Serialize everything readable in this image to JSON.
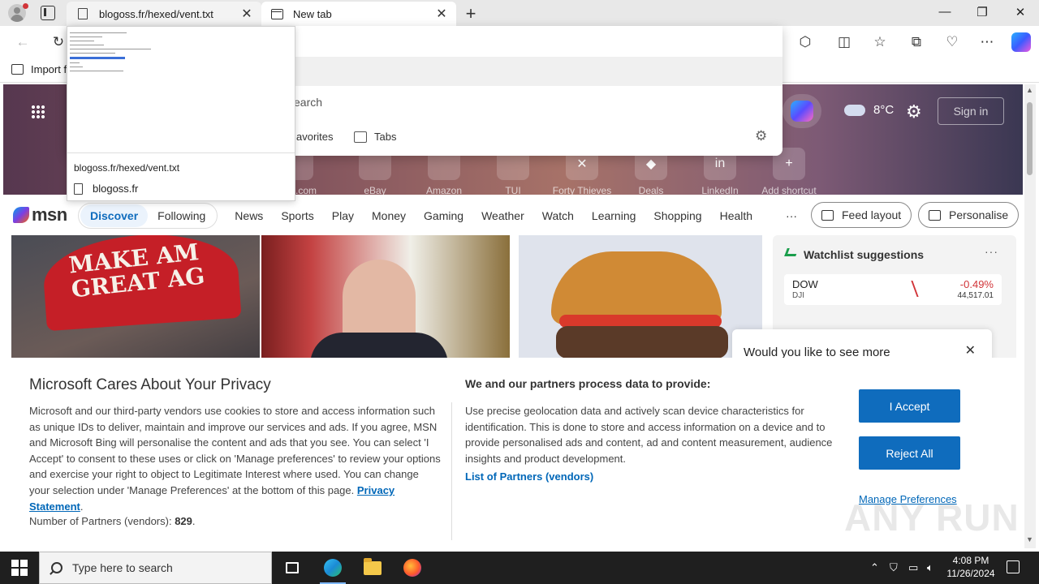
{
  "browser": {
    "tabs": [
      {
        "label": "blogoss.fr/hexed/vent.txt",
        "close": "✕"
      },
      {
        "label": "New tab",
        "close": "✕"
      }
    ],
    "new_tab": "+",
    "window_controls": {
      "minimize": "—",
      "maximize": "❐",
      "close": "✕"
    },
    "favorites_bar": {
      "import_label": "Import f"
    }
  },
  "address_dropdown": {
    "search_placeholder": "earch",
    "favorites_label": "avorites",
    "tabs_label": "Tabs"
  },
  "tab_preview": {
    "url": "blogoss.fr/hexed/vent.txt",
    "site": "blogoss.fr"
  },
  "msn": {
    "weather_temp": "8°C",
    "sign_in": "Sign in",
    "shortcuts": [
      "king.com",
      "eBay",
      "Amazon",
      "TUI",
      "Forty Thieves",
      "Deals",
      "LinkedIn",
      "Add shortcut"
    ],
    "logo": "msn",
    "nav_segment": [
      "Discover",
      "Following"
    ],
    "nav": [
      "News",
      "Sports",
      "Play",
      "Money",
      "Gaming",
      "Weather",
      "Watch",
      "Learning",
      "Shopping",
      "Health"
    ],
    "nav_more": "···",
    "feed_layout": "Feed layout",
    "personalise": "Personalise",
    "hero_cap_text": "MAKE AM\nGREAT AG",
    "watchlist": {
      "title": "Watchlist suggestions",
      "more": "···",
      "stock": {
        "symbol": "DOW",
        "sub": "DJI",
        "change": "-0.49%",
        "value": "44,517.01"
      }
    },
    "toast": "Would you like to see more"
  },
  "privacy": {
    "title": "Microsoft Cares About Your Privacy",
    "body": "Microsoft and our third-party vendors use cookies to store and access information such as unique IDs to deliver, maintain and improve our services and ads. If you agree, MSN and Microsoft Bing will personalise the content and ads that you see. You can select 'I Accept' to consent to these uses or click on 'Manage preferences' to review your options and exercise your right to object to Legitimate Interest where used.  You can change your selection under 'Manage Preferences' at the bottom of this page.",
    "privacy_link": "Privacy Statement",
    "partners_count_label": "Number of Partners (vendors):",
    "partners_count": "829",
    "right_title": "We and our partners process data to provide:",
    "right_body": "Use precise geolocation data and actively scan device characteristics for identification. This is done to store and access information on a device and to provide personalised ads and content, ad and content measurement, audience insights and product development.",
    "partners_link": "List of Partners (vendors)",
    "accept": "I Accept",
    "reject": "Reject All",
    "manage": "Manage Preferences",
    "watermark": "ANY RUN"
  },
  "taskbar": {
    "search_placeholder": "Type here to search",
    "time": "4:08 PM",
    "date": "11/26/2024"
  }
}
